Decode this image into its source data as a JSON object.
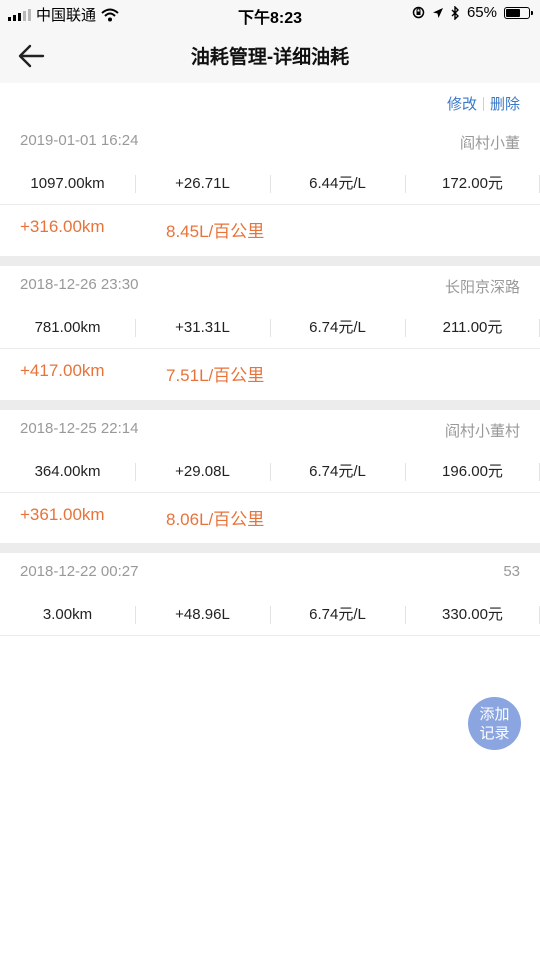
{
  "status_bar": {
    "carrier": "中国联通",
    "time": "下午8:23",
    "battery": "65%",
    "battery_level": 0.65
  },
  "nav": {
    "title": "油耗管理-详细油耗"
  },
  "actions": {
    "edit_label": "修改",
    "delete_label": "删除"
  },
  "records": [
    {
      "date": "2019-01-01 16:24",
      "location": "阎村小董",
      "mileage": "1097.00km",
      "fuel": "+26.71L",
      "price": "6.44元/L",
      "cost": "172.00元",
      "distance_delta": "+316.00km",
      "consumption": "8.45L/百公里"
    },
    {
      "date": "2018-12-26 23:30",
      "location": "长阳京深路",
      "mileage": "781.00km",
      "fuel": "+31.31L",
      "price": "6.74元/L",
      "cost": "211.00元",
      "distance_delta": "+417.00km",
      "consumption": "7.51L/百公里"
    },
    {
      "date": "2018-12-25 22:14",
      "location": "阎村小董村",
      "mileage": "364.00km",
      "fuel": "+29.08L",
      "price": "6.74元/L",
      "cost": "196.00元",
      "distance_delta": "+361.00km",
      "consumption": "8.06L/百公里"
    },
    {
      "date": "2018-12-22 00:27",
      "location": "53",
      "mileage": "3.00km",
      "fuel": "+48.96L",
      "price": "6.74元/L",
      "cost": "330.00元"
    }
  ],
  "fab": {
    "line1": "添加",
    "line2": "记录"
  },
  "colors": {
    "accent_orange": "#e8733a",
    "link_blue": "#3a78c9",
    "fab_blue": "#8aa5df"
  }
}
